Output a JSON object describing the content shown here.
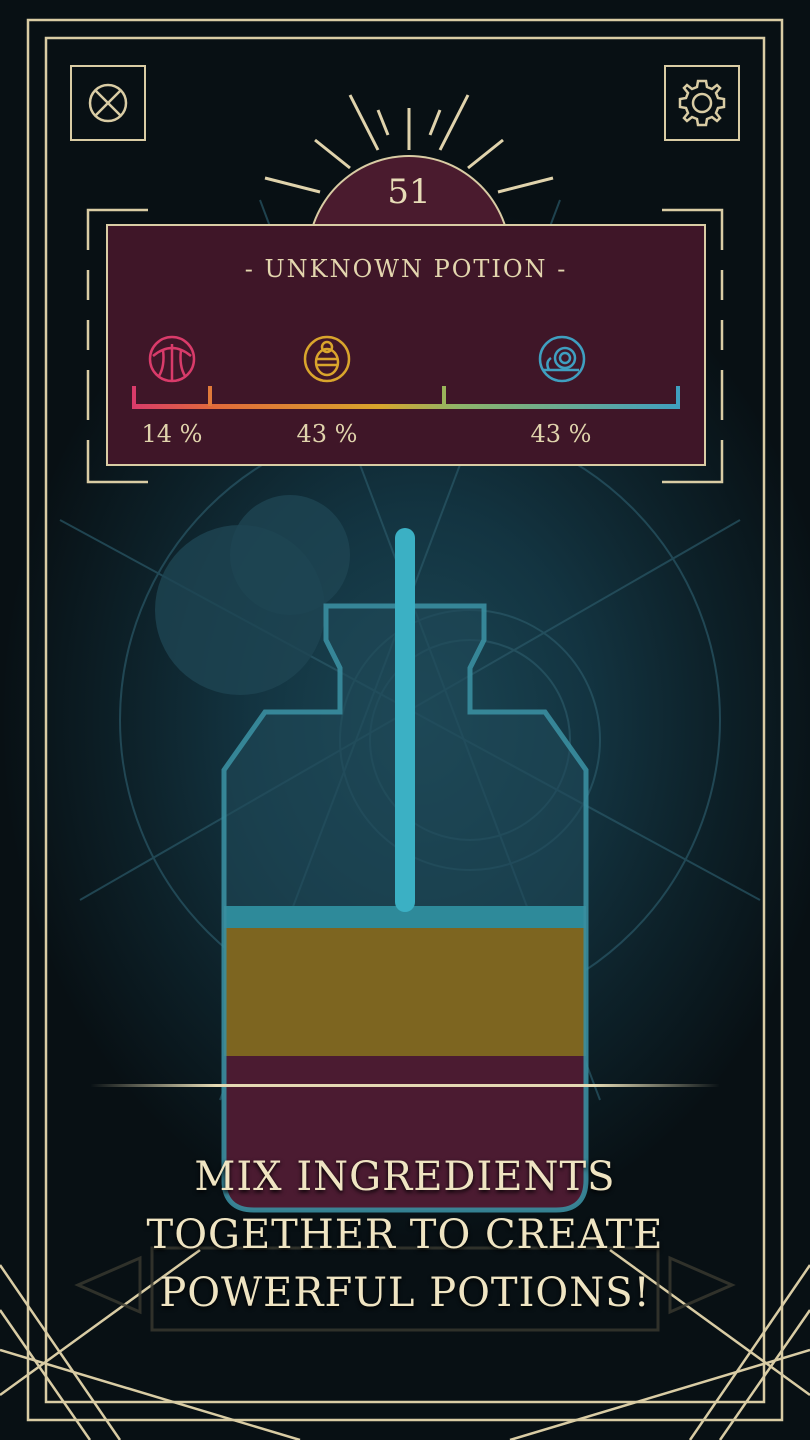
{
  "screen": {
    "score": "51",
    "potion_title": "- UNKNOWN  POTION -",
    "caption_lines": [
      "MIX INGREDIENTS",
      "TOGETHER TO CREATE",
      "POWERFUL POTIONS!"
    ]
  },
  "toolbar": {
    "close_icon": "circle-x-icon",
    "settings_icon": "gear-icon"
  },
  "ingredients": [
    {
      "icon": "red-orb-icon",
      "color": "#d93b6a",
      "percent_label": "14 %",
      "percent": 14
    },
    {
      "icon": "golden-beetle-icon",
      "color": "#d9a52c",
      "percent_label": "43 %",
      "percent": 43
    },
    {
      "icon": "blue-snail-icon",
      "color": "#3f9fc0",
      "percent_label": "43 %",
      "percent": 43
    }
  ],
  "bottle": {
    "layers": [
      {
        "name": "red",
        "color": "#4b1b31"
      },
      {
        "name": "gold",
        "color": "#7d6520"
      },
      {
        "name": "blue",
        "color": "#2e8a9a"
      }
    ]
  },
  "colors": {
    "accent": "#d9cca4",
    "panel": "#3f1628",
    "background": "#133441"
  }
}
